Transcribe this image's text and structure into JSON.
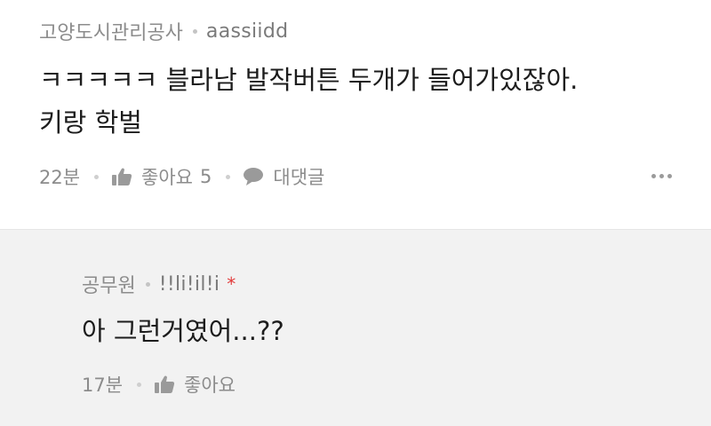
{
  "comment": {
    "author": "고양도시관리공사",
    "nickname": "aassiidd",
    "line1": "ㅋㅋㅋㅋㅋ 블라남 발작버튼 두개가 들어가있잖아.",
    "line2": "키랑 학벌",
    "time": "22분",
    "like_label": "좋아요",
    "like_count": "5",
    "reply_label": "대댓글",
    "icons": [
      "thumbs-up-icon",
      "speech-bubble-icon",
      "more-icon"
    ]
  },
  "reply": {
    "author": "공무원",
    "nickname": "!!li!il!i",
    "mark": "*",
    "text": "아 그런거였어...??",
    "time": "17분",
    "like_label": "좋아요",
    "icons": [
      "thumbs-up-icon"
    ]
  },
  "colors": {
    "meta_text": "#8c8c8c",
    "body_text": "#1c1c1c",
    "reply_background": "#f2f2f2",
    "mark": "#e23a3a"
  }
}
